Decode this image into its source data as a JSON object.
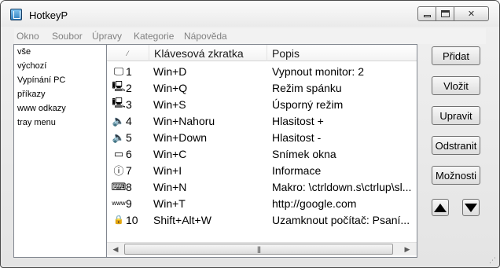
{
  "window": {
    "title": "HotkeyP",
    "close_label": "✕"
  },
  "menu": [
    "Okno",
    "Soubor",
    "Úpravy",
    "Kategorie",
    "Nápověda"
  ],
  "categories": [
    "vše",
    "výchozí",
    "Vypínání PC",
    "příkazy",
    "www odkazy",
    "tray menu"
  ],
  "list": {
    "headers": {
      "sort": "⁄",
      "key": "Klávesová zkratka",
      "desc": "Popis"
    },
    "rows": [
      {
        "icon": "monitor-icon",
        "glyph": "🖵",
        "num": "1",
        "key": "Win+D",
        "desc": "Vypnout monitor: 2"
      },
      {
        "icon": "computer-icon",
        "glyph": "🖳",
        "num": "2",
        "key": "Win+Q",
        "desc": "Režim spánku"
      },
      {
        "icon": "computer-icon",
        "glyph": "🖳",
        "num": "3",
        "key": "Win+S",
        "desc": "Úsporný režim"
      },
      {
        "icon": "volume-up-icon",
        "glyph": "🔈",
        "num": "4",
        "key": "Win+Nahoru",
        "desc": "Hlasitost +"
      },
      {
        "icon": "volume-down-icon",
        "glyph": "🔈",
        "num": "5",
        "key": "Win+Down",
        "desc": "Hlasitost -"
      },
      {
        "icon": "window-icon",
        "glyph": "▭",
        "num": "6",
        "key": "Win+C",
        "desc": "Snímek okna"
      },
      {
        "icon": "info-icon",
        "glyph": "ⓘ",
        "num": "7",
        "key": "Win+I",
        "desc": "Informace"
      },
      {
        "icon": "keyboard-icon",
        "glyph": "⌨",
        "num": "8",
        "key": "Win+N",
        "desc": "Makro: \\ctrldown.s\\ctrlup\\sl..."
      },
      {
        "icon": "www-icon",
        "glyph": "www",
        "num": "9",
        "key": "Win+T",
        "desc": "http://google.com"
      },
      {
        "icon": "lock-icon",
        "glyph": "🔒",
        "num": "10",
        "key": "Shift+Alt+W",
        "desc": "Uzamknout počítač: Psaní..."
      }
    ]
  },
  "buttons": {
    "add": "Přidat",
    "insert": "Vložit",
    "edit": "Upravit",
    "remove": "Odstranit",
    "options": "Možnosti"
  },
  "scrollbar": {
    "left": "◀",
    "right": "▶",
    "grip": "|||"
  }
}
